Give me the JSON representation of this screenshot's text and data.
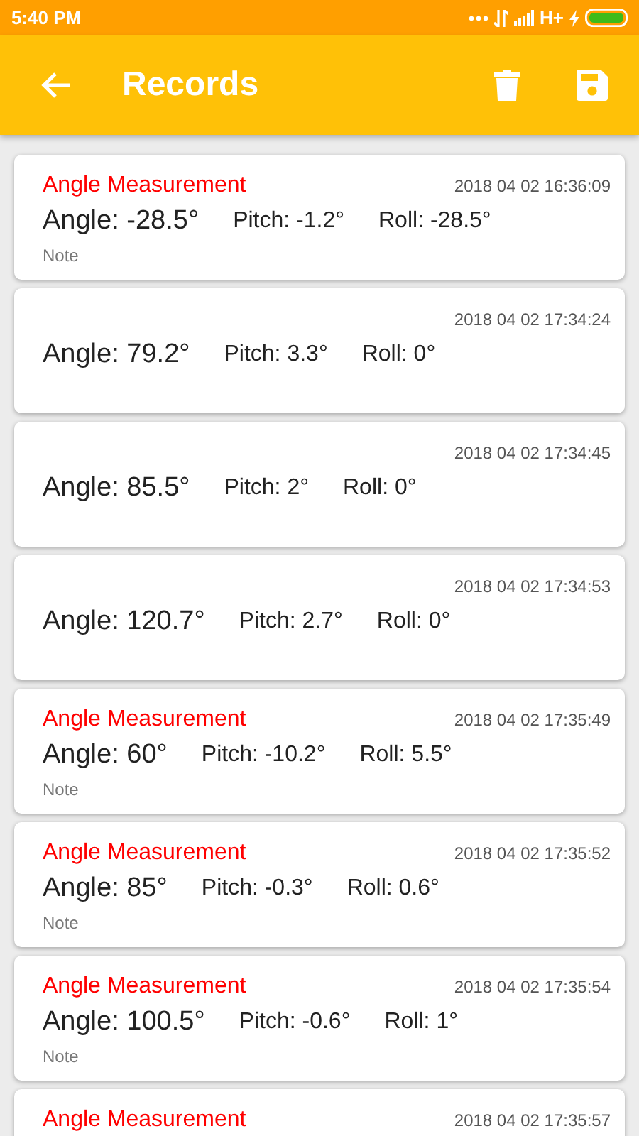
{
  "status_bar": {
    "time": "5:40 PM",
    "network": "H+"
  },
  "app_bar": {
    "title": "Records"
  },
  "records": [
    {
      "title": "Angle Measurement",
      "time": "2018 04 02 16:36:09",
      "angle": "Angle: -28.5°",
      "pitch": "Pitch: -1.2°",
      "roll": "Roll: -28.5°",
      "note": "Note"
    },
    {
      "time": "2018 04 02 17:34:24",
      "angle": "Angle: 79.2°",
      "pitch": "Pitch: 3.3°",
      "roll": "Roll: 0°"
    },
    {
      "time": "2018 04 02 17:34:45",
      "angle": "Angle: 85.5°",
      "pitch": "Pitch: 2°",
      "roll": "Roll: 0°"
    },
    {
      "time": "2018 04 02 17:34:53",
      "angle": "Angle: 120.7°",
      "pitch": "Pitch: 2.7°",
      "roll": "Roll: 0°"
    },
    {
      "title": "Angle Measurement",
      "time": "2018 04 02 17:35:49",
      "angle": "Angle: 60°",
      "pitch": "Pitch: -10.2°",
      "roll": "Roll: 5.5°",
      "note": "Note"
    },
    {
      "title": "Angle Measurement",
      "time": "2018 04 02 17:35:52",
      "angle": "Angle: 85°",
      "pitch": "Pitch: -0.3°",
      "roll": "Roll: 0.6°",
      "note": "Note"
    },
    {
      "title": "Angle Measurement",
      "time": "2018 04 02 17:35:54",
      "angle": "Angle: 100.5°",
      "pitch": "Pitch: -0.6°",
      "roll": "Roll: 1°",
      "note": "Note"
    },
    {
      "title": "Angle Measurement",
      "time": "2018 04 02 17:35:57"
    }
  ]
}
